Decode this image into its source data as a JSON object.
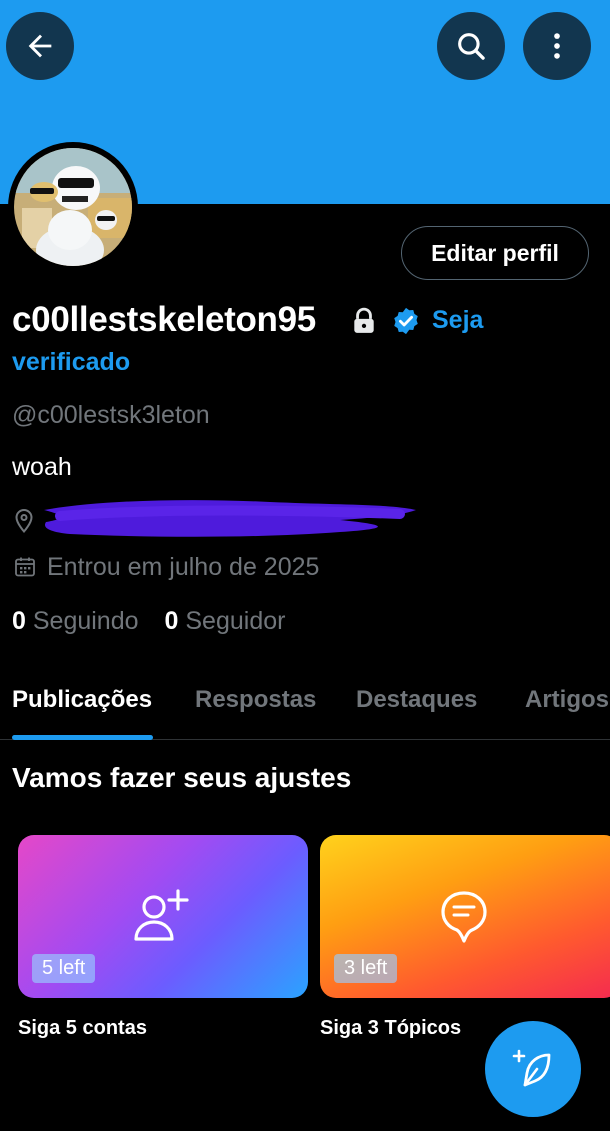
{
  "profile": {
    "display_name": "c00llestskeleton95",
    "get_verified_line1": "Seja",
    "get_verified_line2": "verificado",
    "handle": "@c00lestsk3leton",
    "bio": "woah",
    "joined": "Entrou em julho de 2025",
    "edit_button": "Editar perfil",
    "following_count": "0",
    "following_label": "Seguindo",
    "followers_count": "0",
    "followers_label": "Seguidor"
  },
  "tabs": [
    {
      "label": "Publicações",
      "active": true
    },
    {
      "label": "Respostas",
      "active": false
    },
    {
      "label": "Destaques",
      "active": false
    },
    {
      "label": "Artigos",
      "active": false
    }
  ],
  "onboarding": {
    "title": "Vamos fazer seus ajustes",
    "cards": [
      {
        "badge": "5 left",
        "caption": "Siga 5 contas",
        "icon": "add-user-icon"
      },
      {
        "badge": "3 left",
        "caption": "Siga 3 Tópicos",
        "icon": "topic-bubble-icon"
      }
    ]
  },
  "icons": {
    "back": "arrow-left-icon",
    "search": "search-icon",
    "more": "more-vertical-icon",
    "lock": "lock-icon",
    "verified": "verified-badge-icon",
    "location": "location-pin-icon",
    "calendar": "calendar-icon",
    "compose": "compose-feather-icon"
  },
  "colors": {
    "accent": "#1d9bf0",
    "background": "#000000",
    "muted_text": "#71767b",
    "redaction": "#4e1bdc"
  }
}
